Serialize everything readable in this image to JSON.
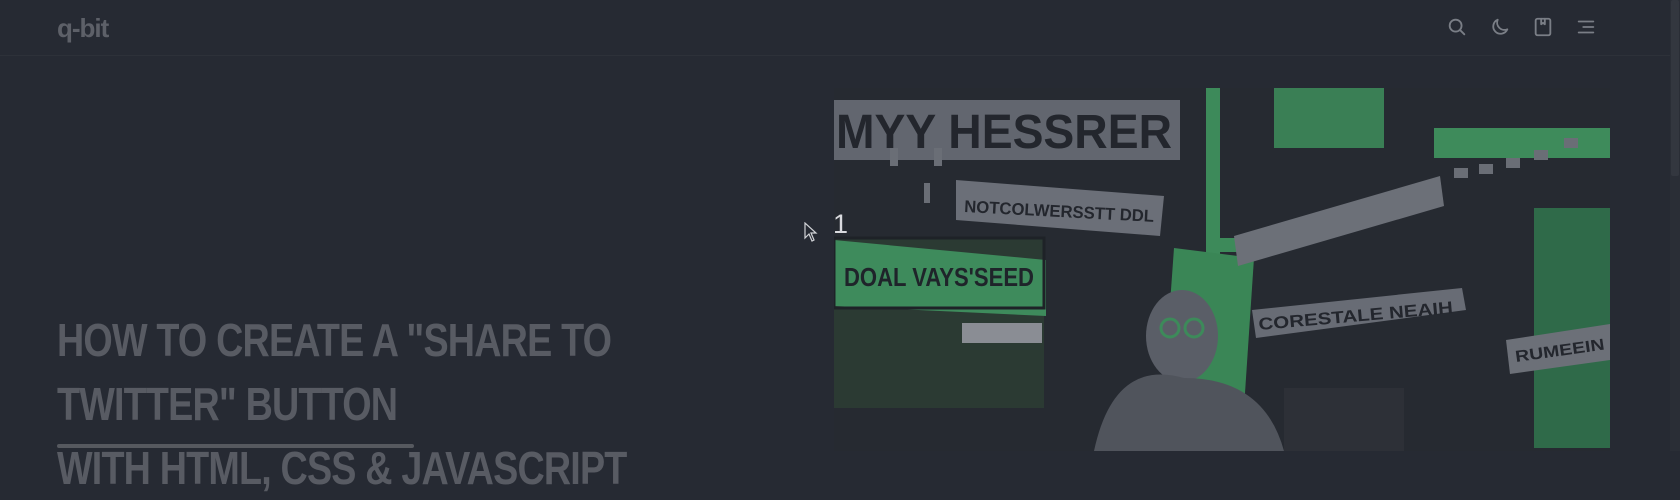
{
  "header": {
    "logo": "q-bit",
    "icons": [
      "search-icon",
      "moon-icon",
      "bookmark-icon",
      "menu-icon"
    ]
  },
  "hero": {
    "slide_number": "1",
    "image_signs": {
      "top_left": "MYY HESSRER",
      "sign_2": "NOTCOLWERSSTT DDL",
      "sign_3": "DOAL VAYS'SEED",
      "sign_4": "CORESTALE NEAIH",
      "sign_5": "RUMEEIN"
    }
  },
  "post": {
    "title": "HOW TO CREATE A \"SHARE TO TWITTER\" BUTTON\nWITH HTML, CSS & JAVASCRIPT"
  },
  "colors": {
    "background": "#262a33",
    "title": "#585b63",
    "accent_green": "#3f8a5c"
  }
}
